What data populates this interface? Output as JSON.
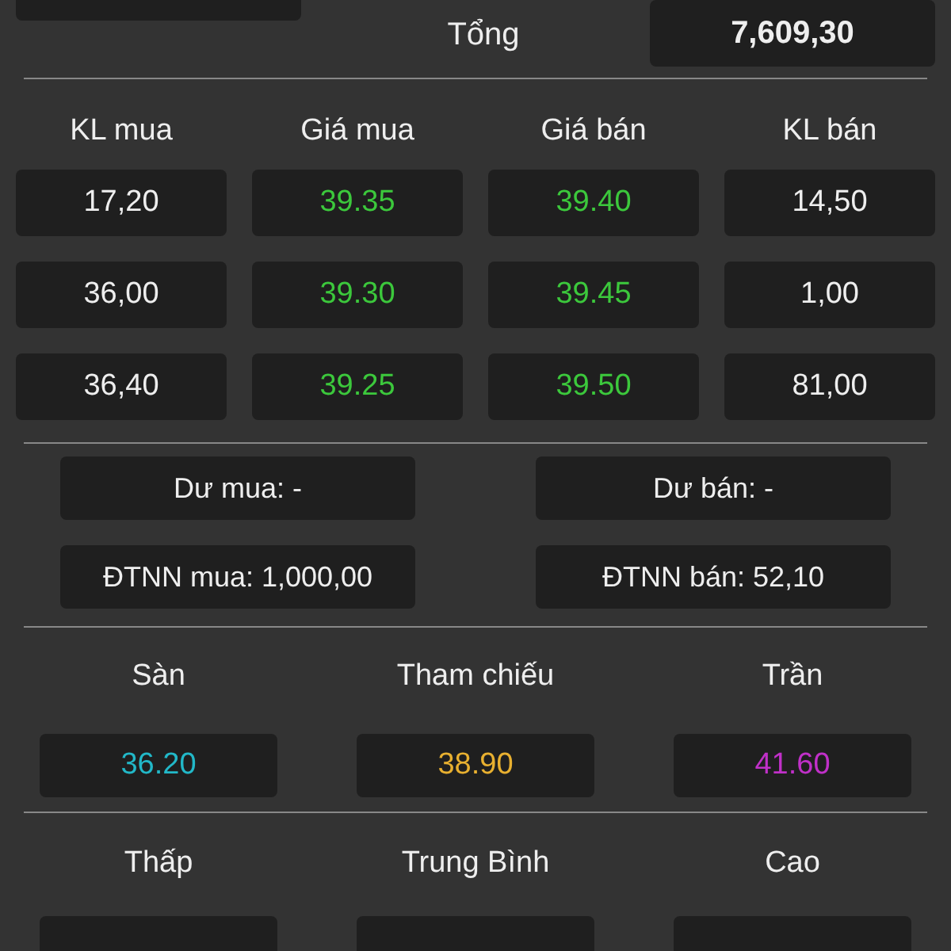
{
  "total": {
    "label": "Tổng",
    "value": "7,609,30"
  },
  "order_book": {
    "columns": [
      "KL mua",
      "Giá mua",
      "Giá bán",
      "KL bán"
    ],
    "rows": [
      [
        "17,20",
        "39.35",
        "39.40",
        "14,50"
      ],
      [
        "36,00",
        "39.30",
        "39.45",
        "1,00"
      ],
      [
        "36,40",
        "39.25",
        "39.50",
        "81,00"
      ]
    ]
  },
  "summary": [
    [
      "Dư mua: -",
      "Dư bán: -"
    ],
    [
      "ĐTNN mua: 1,000,00",
      "ĐTNN bán: 52,10"
    ]
  ],
  "reference": [
    {
      "label": "Sàn",
      "value": "36.20",
      "color": "#22b8c8"
    },
    {
      "label": "Tham chiếu",
      "value": "38.90",
      "color": "#e8b030"
    },
    {
      "label": "Trần",
      "value": "41.60",
      "color": "#c030c8"
    }
  ],
  "range": [
    {
      "label": "Thấp"
    },
    {
      "label": "Trung Bình"
    },
    {
      "label": "Cao"
    }
  ]
}
